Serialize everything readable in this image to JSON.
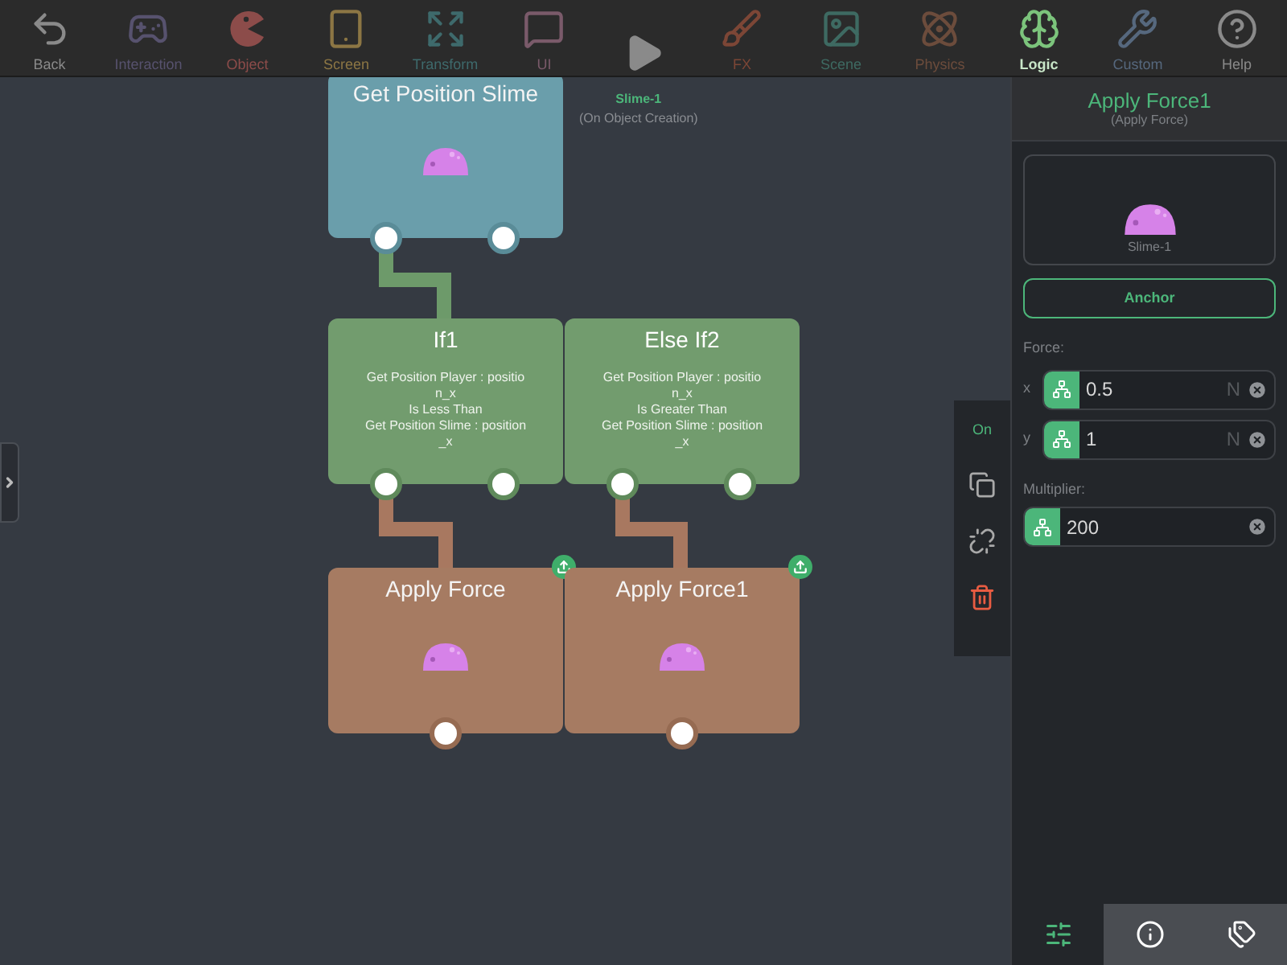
{
  "toolbar": {
    "items": [
      {
        "kind": "back",
        "label": "Back",
        "color": "#8a8a8a",
        "selected": false
      },
      {
        "kind": "gamepad",
        "label": "Interaction",
        "color": "#57526e",
        "selected": false
      },
      {
        "kind": "pacman",
        "label": "Object",
        "color": "#8c4c4a",
        "selected": false
      },
      {
        "kind": "tablet",
        "label": "Screen",
        "color": "#8c7644",
        "selected": false
      },
      {
        "kind": "expand",
        "label": "Transform",
        "color": "#3e6a6c",
        "selected": false
      },
      {
        "kind": "chat",
        "label": "UI",
        "color": "#7a5a6a",
        "selected": false
      },
      {
        "kind": "play",
        "color": "#8a8a8a"
      },
      {
        "kind": "fx",
        "label": "FX",
        "color": "#7c4636",
        "selected": false
      },
      {
        "kind": "image",
        "label": "Scene",
        "color": "#3e6a62",
        "selected": false
      },
      {
        "kind": "atom",
        "label": "Physics",
        "color": "#6c4c3c",
        "selected": false
      },
      {
        "kind": "brain",
        "label": "Logic",
        "color": "#7cc47c",
        "selected": true
      },
      {
        "kind": "wrench",
        "label": "Custom",
        "color": "#56687e",
        "selected": false
      },
      {
        "kind": "help",
        "label": "Help",
        "color": "#8a8a8a",
        "selected": false
      }
    ]
  },
  "canvas": {
    "object_tag": {
      "name": "Slime-1",
      "event": "(On Object Creation)"
    },
    "nodes": [
      {
        "kind": "getter",
        "title": "Get Position Slime",
        "sprite": true
      },
      {
        "kind": "condition",
        "title": "If1",
        "text": "Get Position Player : positio\nn_x\nIs Less Than\nGet Position Slime : position\n_x"
      },
      {
        "kind": "condition",
        "title": "Else If2",
        "text": "Get Position Player : positio\nn_x\nIs Greater Than\nGet Position Slime : position\n_x"
      },
      {
        "kind": "action",
        "title": "Apply Force",
        "sprite": true,
        "upload": true
      },
      {
        "kind": "action",
        "title": "Apply Force1",
        "sprite": true,
        "upload": true
      }
    ]
  },
  "side_tools": {
    "toggle": "On",
    "items": [
      {
        "kind": "copy"
      },
      {
        "kind": "unlink"
      },
      {
        "kind": "delete"
      }
    ]
  },
  "inspector": {
    "title": "Apply Force1",
    "subtitle": "(Apply Force)",
    "preview_label": "Slime-1",
    "anchor_button": "Anchor",
    "force_label": "Force:",
    "force_fields": [
      {
        "axis": "x",
        "value": "0.5",
        "unit": "N"
      },
      {
        "axis": "y",
        "value": "1",
        "unit": "N"
      }
    ],
    "multiplier_label": "Multiplier:",
    "multiplier_value": "200",
    "bottom_tabs": [
      {
        "kind": "sliders",
        "selected": true
      },
      {
        "kind": "info",
        "selected": false
      },
      {
        "kind": "tags",
        "selected": false
      }
    ]
  }
}
